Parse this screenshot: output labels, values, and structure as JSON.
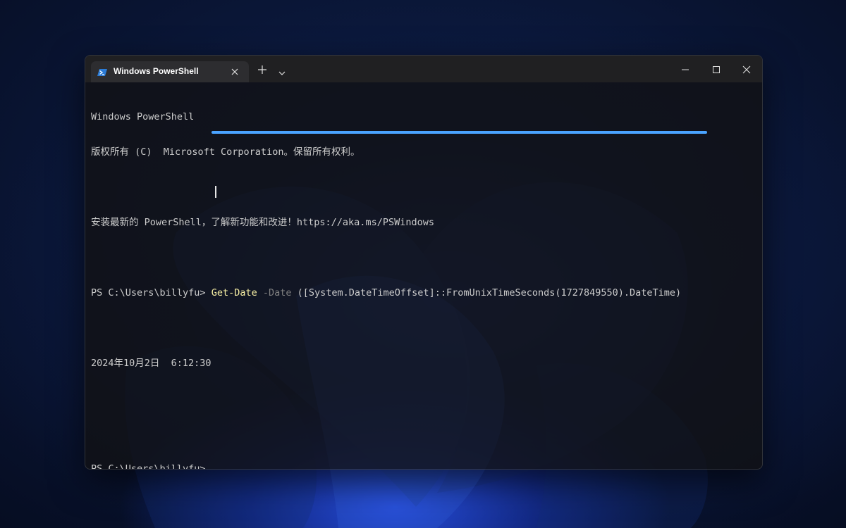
{
  "window": {
    "tab_title": "Windows PowerShell"
  },
  "terminal": {
    "line1": "Windows PowerShell",
    "line2": "版权所有 (C)  Microsoft Corporation。保留所有权利。",
    "line3": "安装最新的 PowerShell，了解新功能和改进！https://aka.ms/PSWindows",
    "prompt1": "PS C:\\Users\\billyfu> ",
    "command": {
      "cmdlet": "Get-Date",
      "parameter": " -Date",
      "argument": " ([System.DateTimeOffset]::FromUnixTimeSeconds(1727849550).DateTime)"
    },
    "output": "2024年10月2日  6:12:30",
    "prompt2": "PS C:\\Users\\billyfu> "
  },
  "icons": {
    "tab_icon": "powershell-icon",
    "tab_close": "close-icon",
    "new_tab": "plus-icon",
    "dropdown": "chevron-down-icon",
    "minimize": "minimize-icon",
    "maximize": "maximize-icon",
    "close": "close-icon"
  },
  "colors": {
    "cmdlet": "#f9f1a5",
    "parameter": "#808080",
    "text": "#cccccc",
    "highlight": "#4aa3ff"
  }
}
